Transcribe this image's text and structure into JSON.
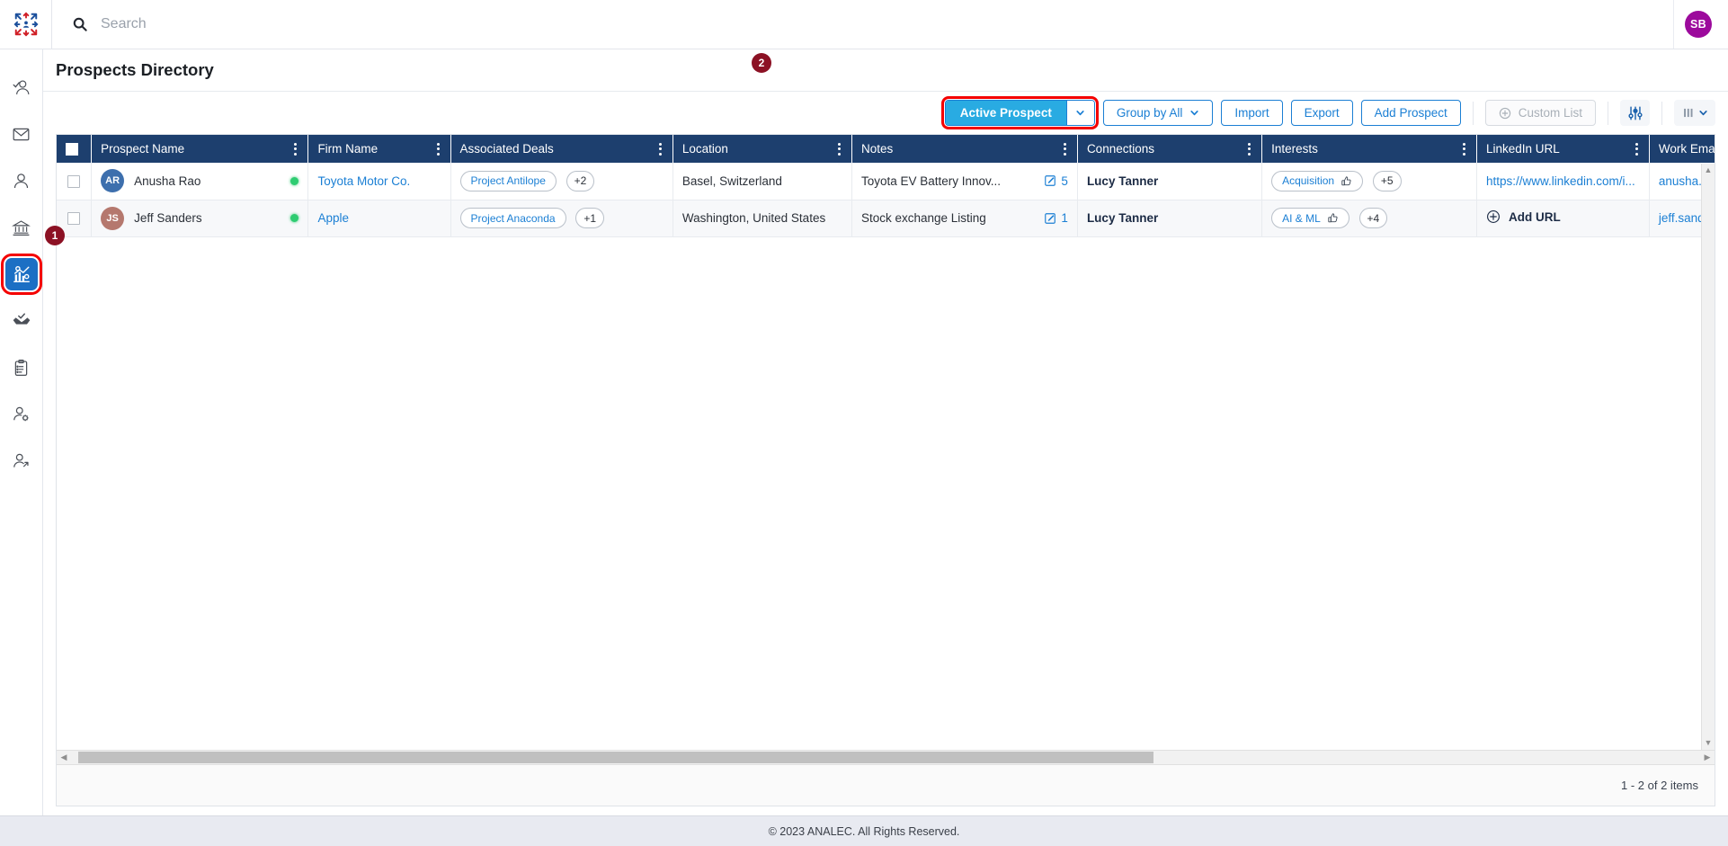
{
  "app": {
    "logo_icon": "analec-logo-icon",
    "footer_text": "© 2023 ANALEC. All Rights Reserved."
  },
  "topbar": {
    "search_placeholder": "Search",
    "search_value": "",
    "search_icon": "search-icon",
    "user_initials": "SB",
    "user_avatar_color": "#9c0a9c"
  },
  "sidebar": {
    "items": [
      {
        "icon": "user-check-icon",
        "name": "contacts",
        "active": false
      },
      {
        "icon": "envelope-icon",
        "name": "messages",
        "active": false
      },
      {
        "icon": "user-icon",
        "name": "people",
        "active": false
      },
      {
        "icon": "bank-icon",
        "name": "institutions",
        "active": false
      },
      {
        "icon": "analytics-gear-icon",
        "name": "prospects",
        "active": true
      },
      {
        "icon": "handshake-check-icon",
        "name": "deals",
        "active": false
      },
      {
        "icon": "clipboard-list-icon",
        "name": "tasks",
        "active": false
      },
      {
        "icon": "user-settings-icon",
        "name": "user-settings",
        "active": false
      },
      {
        "icon": "user-export-icon",
        "name": "user-export",
        "active": false
      }
    ]
  },
  "markers": [
    {
      "label": "1",
      "target": "sidebar-item-prospects"
    },
    {
      "label": "2",
      "target": "active-prospect-button"
    }
  ],
  "page": {
    "title": "Prospects Directory"
  },
  "toolbar": {
    "active_prospect_label": "Active Prospect",
    "group_by_label": "Group by All",
    "import_label": "Import",
    "export_label": "Export",
    "add_prospect_label": "Add Prospect",
    "custom_list_label": "Custom List",
    "filter_icon": "sliders-icon",
    "columns_icon": "columns-icon",
    "accent_color": "#29abe2",
    "link_color": "#1b7fd4"
  },
  "grid": {
    "header_bg": "#1d3f6e",
    "columns": [
      {
        "key": "select",
        "label": "",
        "menu": false
      },
      {
        "key": "prospect_name",
        "label": "Prospect Name",
        "menu": true
      },
      {
        "key": "firm_name",
        "label": "Firm Name",
        "menu": true
      },
      {
        "key": "associated_deals",
        "label": "Associated Deals",
        "menu": true
      },
      {
        "key": "location",
        "label": "Location",
        "menu": true
      },
      {
        "key": "notes",
        "label": "Notes",
        "menu": true
      },
      {
        "key": "connections",
        "label": "Connections",
        "menu": true
      },
      {
        "key": "interests",
        "label": "Interests",
        "menu": true
      },
      {
        "key": "linkedin_url",
        "label": "LinkedIn URL",
        "menu": true
      },
      {
        "key": "work_email",
        "label": "Work Email",
        "menu": false
      }
    ],
    "rows": [
      {
        "initials": "AR",
        "avatar_color": "#3d6fad",
        "prospect_name": "Anusha Rao",
        "status": "active",
        "firm_name": "Toyota Motor Co.",
        "deal_chip": "Project Antilope",
        "deal_more": "+2",
        "location": "Basel, Switzerland",
        "notes": "Toyota EV Battery Innov...",
        "notes_count": "5",
        "connections": "Lucy Tanner",
        "interest_chip": "Acquisition",
        "interest_more": "+5",
        "linkedin_url": "https://www.linkedin.com/i...",
        "linkedin_is_link": true,
        "work_email": "anusha.rao("
      },
      {
        "initials": "JS",
        "avatar_color": "#b5786e",
        "prospect_name": "Jeff Sanders",
        "status": "active",
        "firm_name": "Apple",
        "deal_chip": "Project Anaconda",
        "deal_more": "+1",
        "location": "Washington, United States",
        "notes": "Stock exchange Listing",
        "notes_count": "1",
        "connections": "Lucy Tanner",
        "interest_chip": "AI & ML",
        "interest_more": "+4",
        "linkedin_url": "Add URL",
        "linkedin_is_link": false,
        "work_email": "jeff.sanders"
      }
    ]
  },
  "pager": {
    "items_text": "1 - 2 of 2 items"
  }
}
